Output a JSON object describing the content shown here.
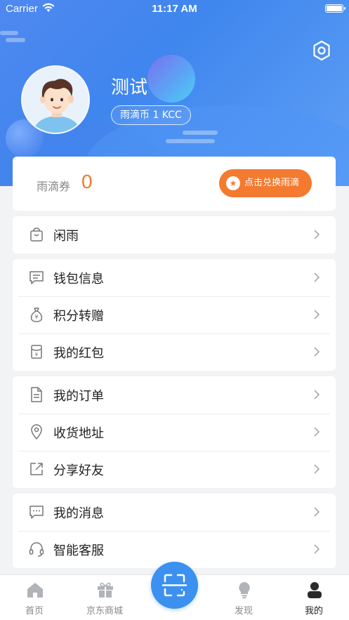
{
  "status_bar": {
    "carrier": "Carrier",
    "time": "11:17 AM"
  },
  "profile": {
    "username": "测试",
    "coin_badge": "雨滴币 1 KCC"
  },
  "voucher": {
    "label": "雨滴券",
    "count": "0",
    "exchange_button": "点击兑换雨滴"
  },
  "menu_groups": [
    {
      "items": [
        {
          "label": "闲雨",
          "icon": "bag-icon"
        }
      ]
    },
    {
      "items": [
        {
          "label": "钱包信息",
          "icon": "message-icon"
        },
        {
          "label": "积分转赠",
          "icon": "money-bag-icon"
        },
        {
          "label": "我的红包",
          "icon": "red-envelope-icon"
        }
      ]
    },
    {
      "items": [
        {
          "label": "我的订单",
          "icon": "document-icon"
        },
        {
          "label": "收货地址",
          "icon": "location-pin-icon"
        },
        {
          "label": "分享好友",
          "icon": "share-icon"
        }
      ]
    },
    {
      "items": [
        {
          "label": "我的消息",
          "icon": "chat-icon"
        },
        {
          "label": "智能客服",
          "icon": "headset-icon"
        }
      ]
    }
  ],
  "tabbar": {
    "tabs": [
      {
        "label": "首页",
        "icon": "home-icon"
      },
      {
        "label": "京东商城",
        "icon": "gift-icon"
      },
      {
        "label": "发现",
        "icon": "lightbulb-icon"
      },
      {
        "label": "我的",
        "icon": "profile-icon",
        "active": true
      }
    ],
    "center": {
      "icon": "scan-icon"
    }
  },
  "colors": {
    "header_blue": "#3f86ee",
    "accent_orange": "#f47a2f",
    "scan_blue": "#3c90ef"
  }
}
